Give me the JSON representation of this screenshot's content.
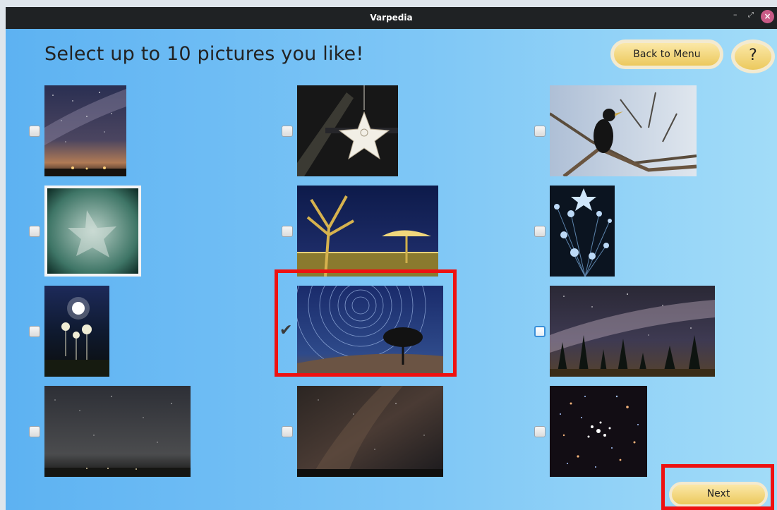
{
  "window": {
    "title": "Varpedia",
    "minimize": "–",
    "maximize": "⤢",
    "close": "×"
  },
  "header": {
    "title": "Select up to 10 pictures you like!",
    "back_button": "Back to Menu",
    "help_button": "?"
  },
  "footer": {
    "next_button": "Next"
  },
  "pictures": [
    {
      "name": "milky-way-coast",
      "checked": false
    },
    {
      "name": "hanging-star-ornament",
      "checked": false
    },
    {
      "name": "starling-on-branch",
      "checked": false
    },
    {
      "name": "frosted-star-polaroid",
      "checked": false
    },
    {
      "name": "night-tree-umbrella",
      "checked": false
    },
    {
      "name": "fiber-optic-star",
      "checked": false
    },
    {
      "name": "moonlit-flowers",
      "checked": false
    },
    {
      "name": "star-trails-tree",
      "checked": true
    },
    {
      "name": "milky-way-trees",
      "checked": false
    },
    {
      "name": "starry-horizon",
      "checked": false
    },
    {
      "name": "dark-starry-sky",
      "checked": false
    },
    {
      "name": "star-cluster",
      "checked": false
    }
  ],
  "colors": {
    "background_start": "#5db2f2",
    "background_end": "#a2dcf8",
    "button_gold": "#ecc95d",
    "highlight": "#ee1111"
  }
}
